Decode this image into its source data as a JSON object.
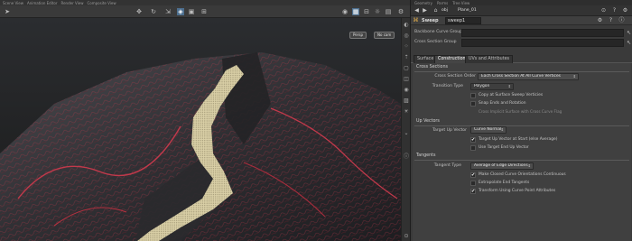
{
  "viewport": {
    "top_tabs": [
      "Scene View",
      "Animation Editor",
      "Render View",
      "Composite View"
    ],
    "persp_label": "Persp",
    "cam_label": "No cam"
  },
  "panel": {
    "top_tabs": [
      "Geometry",
      "Parms",
      "Tree View"
    ],
    "path": "obj",
    "path_node": "Plane_01",
    "node_type": "Sweep",
    "node_name": "sweep1",
    "backbone_label": "Backbone Curve Group",
    "cross_section_label": "Cross Section Group",
    "tabs": [
      {
        "label": "Surface"
      },
      {
        "label": "Construction"
      },
      {
        "label": "UVs and Attributes"
      }
    ],
    "cross_sections": {
      "header": "Cross Sections",
      "order_label": "Cross Section Order",
      "order_value": "Each Cross Section At All Curve Vertices",
      "type_label": "Transition Type",
      "type_value": "Polygon",
      "checks": [
        {
          "label": "Copy at Surface Sweep Verticies",
          "checked": false
        },
        {
          "label": "Snap Ends and Rotation",
          "checked": false
        }
      ],
      "hint": "Cross Implicit Surface with Cross Curve Flag"
    },
    "up_vectors": {
      "header": "Up Vectors",
      "target_label": "Target Up Vector",
      "target_value": "Curve Normal",
      "checks": [
        {
          "label": "Target Up Vector at Start (else Average)",
          "checked": true
        },
        {
          "label": "Use Target End Up Vector",
          "checked": false
        }
      ]
    },
    "tangents": {
      "header": "Tangents",
      "type_label": "Tangent Type",
      "type_value": "Average of Edge Directions",
      "checks": [
        {
          "label": "Make Closed Curve Orientations Continuous",
          "checked": true
        },
        {
          "label": "Extrapolate End Tangents",
          "checked": false
        },
        {
          "label": "Transform Using Curve Point Attributes",
          "checked": true
        }
      ]
    }
  },
  "colors": {
    "terrain_ridge": "#c2394b",
    "road_fill": "#d9cfa6",
    "panel_bg": "#3a3a3a"
  }
}
